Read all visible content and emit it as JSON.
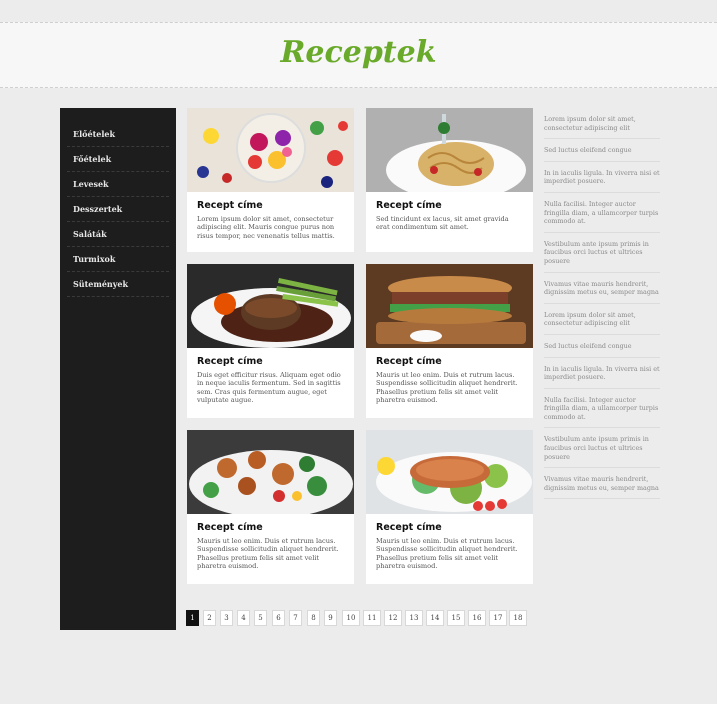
{
  "header": {
    "logo": "Receptek"
  },
  "sidebar": {
    "items": [
      "Előételek",
      "Főételek",
      "Levesek",
      "Desszertek",
      "Saláták",
      "Turmixok",
      "Sütemények"
    ]
  },
  "cards": [
    {
      "title": "Recept címe",
      "text": "Lorem ipsum dolor sit amet, consectetur adipiscing elit. Mauris congue purus non risus tempor, nec venenatis tellus mattis."
    },
    {
      "title": "Recept címe",
      "text": "Sed tincidunt ex lacus, sit amet gravida erat condimentum sit amet."
    },
    {
      "title": "Recept címe",
      "text": "Duis eget efficitur risus. Aliquam eget odio in neque iaculis fermentum. Sed in sagittis sem. Cras quis fermentum augue, eget vulputate augue."
    },
    {
      "title": "Recept címe",
      "text": "Mauris ut leo enim. Duis et rutrum lacus. Suspendisse sollicitudin aliquet hendrerit. Phasellus pretium felis sit amet velit pharetra euismod."
    },
    {
      "title": "Recept címe",
      "text": "Mauris ut leo enim. Duis et rutrum lacus. Suspendisse sollicitudin aliquet hendrerit. Phasellus pretium felis sit amet velit pharetra euismod."
    },
    {
      "title": "Recept címe",
      "text": "Mauris ut leo enim. Duis et rutrum lacus. Suspendisse sollicitudin aliquet hendrerit. Phasellus pretium felis sit amet velit pharetra euismod."
    }
  ],
  "right_column": [
    "Lorem ipsum dolor sit amet, consectetur adipiscing elit",
    "Sed luctus eleifend congue",
    "In in iaculis ligula. In viverra nisi et imperdiet posuere.",
    "Nulla facilisi. Integer auctor fringilla diam, a ullamcorper turpis commodo at.",
    "Vestibulum ante ipsum primis in faucibus orci luctus et ultrices posuere",
    "Vivamus vitae mauris hendrerit, dignissim metus eu, semper magna",
    "Lorem ipsum dolor sit amet, consectetur adipiscing elit",
    "Sed luctus eleifend congue",
    "In in iaculis ligula. In viverra nisi et imperdiet posuere.",
    "Nulla facilisi. Integer auctor fringilla diam, a ullamcorper turpis commodo at.",
    "Vestibulum ante ipsum primis in faucibus orci luctus et ultrices posuere",
    "Vivamus vitae mauris hendrerit, dignissim metus eu, semper magna"
  ],
  "pagination": {
    "pages": [
      "1",
      "2",
      "3",
      "4",
      "5",
      "6",
      "7",
      "8",
      "9",
      "10",
      "11",
      "12",
      "13",
      "14",
      "15",
      "16",
      "17",
      "18"
    ],
    "current": "1"
  }
}
